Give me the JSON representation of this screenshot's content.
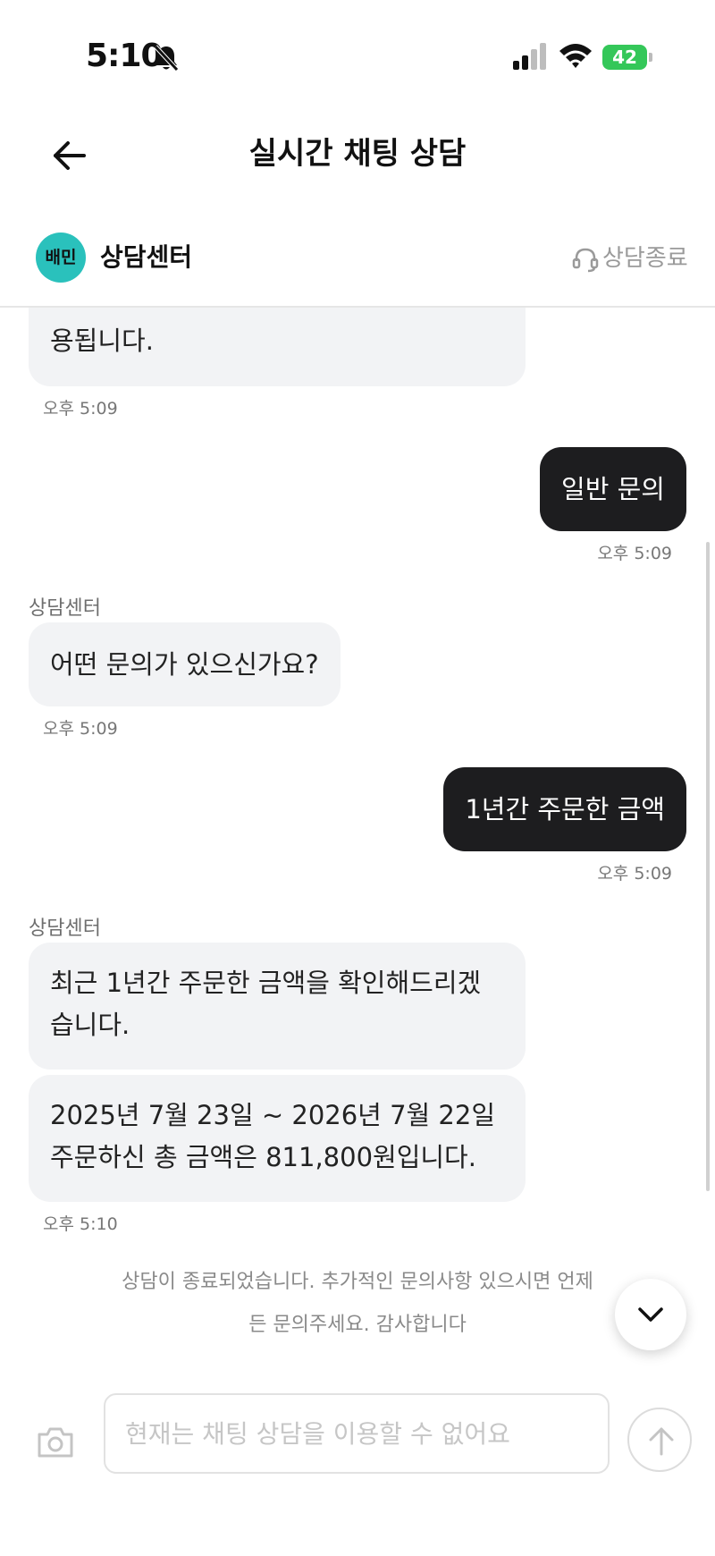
{
  "status_bar": {
    "time": "5:10",
    "battery": "42"
  },
  "header": {
    "title": "실시간 채팅 상담"
  },
  "center": {
    "logo_text": "배민",
    "name": "상담센터",
    "end_label": "상담종료"
  },
  "messages": [
    {
      "kind": "in",
      "lines": [
        "용됩니다."
      ],
      "time": "오후 5:09"
    },
    {
      "kind": "out",
      "text": "일반 문의",
      "time": "오후 5:09"
    },
    {
      "kind": "in",
      "sender": "상담센터",
      "lines": [
        "어떤 문의가 있으신가요?"
      ],
      "time": "오후 5:09"
    },
    {
      "kind": "out",
      "text": "1년간 주문한 금액",
      "time": "오후 5:09"
    },
    {
      "kind": "in",
      "sender": "상담센터",
      "lines": [
        "최근 1년간 주문한 금액을 확인해드리겠",
        "습니다."
      ]
    },
    {
      "kind": "in",
      "lines": [
        "2025년 7월 23일 ~ 2026년 7월 22일",
        "주문하신 총 금액은 811,800원입니다."
      ],
      "time": "오후 5:10"
    }
  ],
  "end_notice": {
    "line1": "상담이 종료되었습니다. 추가적인 문의사항 있으시면 언제",
    "line2": "든 문의주세요. 감사합니다"
  },
  "input": {
    "placeholder": "현재는 채팅 상담을 이용할 수 없어요",
    "value": ""
  },
  "icons": {
    "back": "arrow-left-icon",
    "bell": "bell-off-icon",
    "end_chat": "headset-icon",
    "scroll_down": "chevron-down-icon",
    "camera": "camera-icon",
    "send": "arrow-up-icon"
  },
  "colors": {
    "brand": "#2ac1bc",
    "battery": "#34c759",
    "outgoing_bubble": "#1d1d1f",
    "incoming_bubble": "#f2f3f5"
  }
}
